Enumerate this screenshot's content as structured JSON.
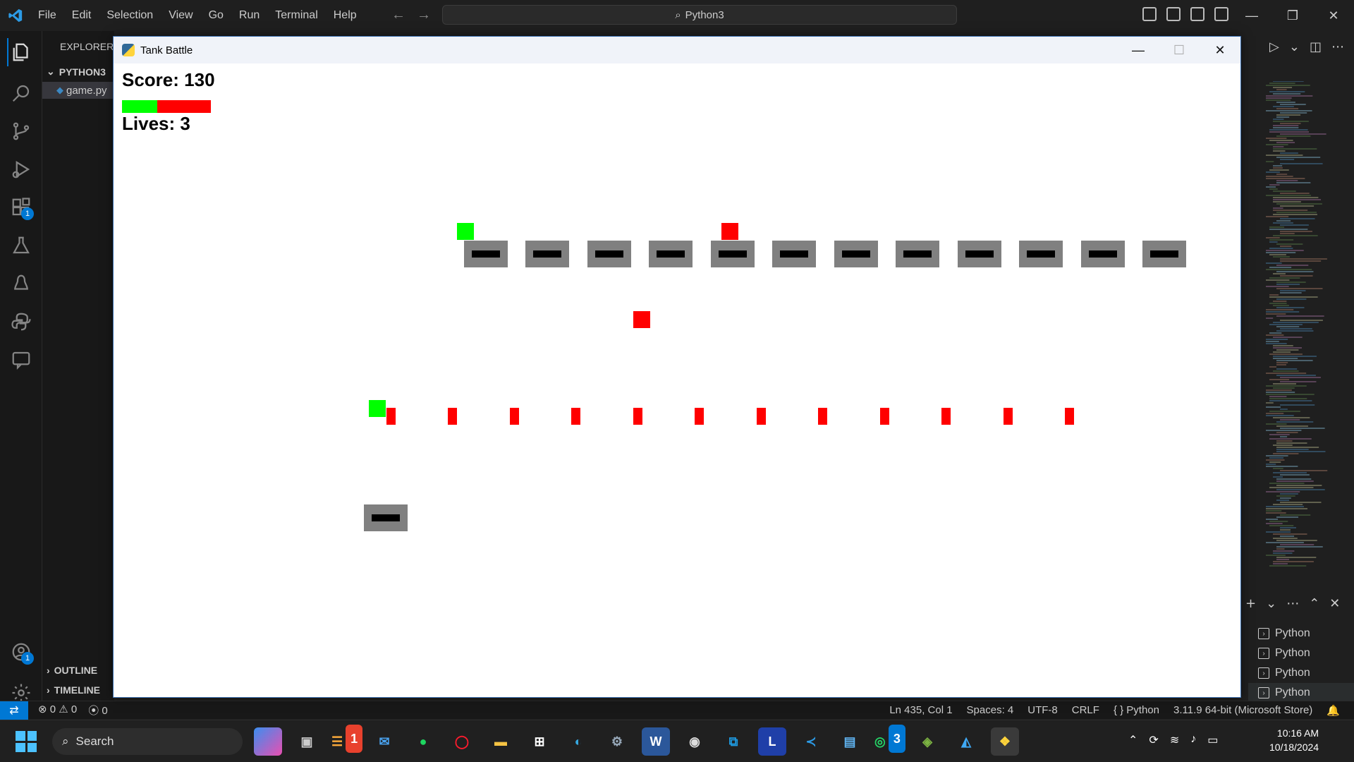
{
  "vscode": {
    "menu": [
      "File",
      "Edit",
      "Selection",
      "View",
      "Go",
      "Run",
      "Terminal",
      "Help"
    ],
    "command_center": "Python3",
    "sidebar": {
      "header": "EXPLORER",
      "folder": "PYTHON3",
      "file": "game.py",
      "outline": "OUTLINE",
      "timeline": "TIMELINE"
    },
    "activity_badges": {
      "extensions": "1",
      "accounts": "1"
    },
    "terminals": [
      "Python",
      "Python",
      "Python",
      "Python"
    ],
    "statusbar": {
      "errors": "0",
      "warnings": "0",
      "ports": "0",
      "position": "Ln 435, Col 1",
      "spaces": "Spaces: 4",
      "encoding": "UTF-8",
      "eol": "CRLF",
      "language": "Python",
      "interpreter": "3.11.9 64-bit (Microsoft Store)"
    }
  },
  "game": {
    "window_title": "Tank Battle",
    "score_label": "Score: 130",
    "lives_label": "Lives: 3",
    "health_fraction": 0.4,
    "colors": {
      "enemy": "#ff0000",
      "player": "#00ff00",
      "tank_body": "#808080",
      "barrel": "#000000"
    }
  },
  "taskbar": {
    "search_placeholder": "Search",
    "time": "10:16 AM",
    "date": "10/18/2024",
    "badges": {
      "app3": "1",
      "whatsapp": "3"
    }
  }
}
